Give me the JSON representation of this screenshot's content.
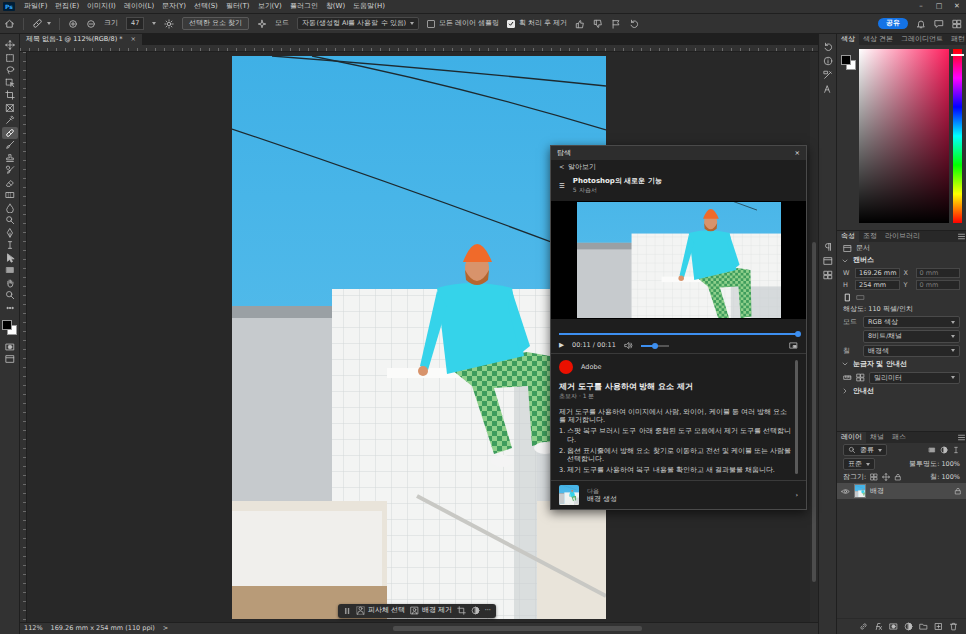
{
  "app": {
    "logo": "Ps"
  },
  "menu": [
    "파일(F)",
    "편집(E)",
    "이미지(I)",
    "레이어(L)",
    "문자(Y)",
    "선택(S)",
    "필터(T)",
    "보기(V)",
    "플러그인",
    "창(W)",
    "도움말(H)"
  ],
  "window_controls": [
    "–",
    "□",
    "✕"
  ],
  "options_bar": {
    "size_label": "크기",
    "size_value": "47",
    "find_button": "선택한 요소 찾기",
    "mode_label": "모드",
    "mode_value": "자동(생성형 AI를 사용할 수 있음)",
    "checks": [
      {
        "label": "모든 레이어 샘플링",
        "checked": false
      },
      {
        "label": "획 처리 후 제거",
        "checked": true
      }
    ],
    "share": "공유"
  },
  "document_tab": {
    "title": "제목 없음-1 @ 112%(RGB/8) *",
    "close": "×"
  },
  "tools": [
    {
      "selected": false
    },
    {
      "selected": false
    },
    {
      "selected": false
    },
    {
      "selected": false
    },
    {
      "selected": false
    },
    {
      "selected": false
    },
    {
      "selected": false
    },
    {
      "selected": true
    },
    {
      "selected": false
    },
    {
      "selected": false
    },
    {
      "selected": false
    },
    {
      "selected": false
    },
    {
      "selected": false
    },
    {
      "selected": false
    },
    {
      "selected": false
    },
    {
      "selected": false
    },
    {
      "selected": false
    },
    {
      "selected": false
    },
    {
      "selected": false
    },
    {
      "selected": false
    },
    {
      "selected": false
    },
    {
      "selected": false
    }
  ],
  "context_bar": {
    "buttons": [
      "피사체 선택",
      "배경 제거"
    ],
    "more": "···"
  },
  "status_bar": {
    "zoom": "112%",
    "info": "169.26 mm x 254 mm (110 ppi)",
    "arrow": ">"
  },
  "help_panel": {
    "title": "탐색",
    "close": "×",
    "back_arrow": "<",
    "back": "알아보기",
    "menu_glyph": "☰",
    "series_title": "Photoshop의 새로운 기능",
    "series_count": "5 자습서",
    "video": {
      "play": "▶",
      "time": "00:11 / 00:11",
      "progress": {
        "level": 1
      },
      "volume": {
        "level": 0.5
      }
    },
    "author": "Adobe",
    "lesson_title": "제거 도구를 사용하여 방해 요소 제거",
    "lesson_meta": "초보자 · 1 분",
    "intro": "제거 도구를 사용하여 이미지에서 사람, 와이어, 케이블 등 여러 방해 요소를 제거합니다.",
    "steps": [
      "1. 스팟 복구 브러시 도구 아래 중첩된 도구 모음에서 제거 도구를 선택합니다.",
      "2. 옵션 표시줄에서 방해 요소 찾기로 이동하고 전선 및 케이블 또는 사람을 선택합니다.",
      "3. 제거 도구를 사용하여 복구 내용을 확인하고 새 결과물을 채웁니다."
    ],
    "next": {
      "label": "다음",
      "title": "배경 생성",
      "arrow": "›"
    }
  },
  "right_panels": {
    "color": {
      "tabs": [
        {
          "label": "색상",
          "selected": true
        },
        {
          "label": "색상 견본",
          "selected": false
        },
        {
          "label": "그레이디언트",
          "selected": false
        },
        {
          "label": "패턴",
          "selected": false
        }
      ],
      "swatches": [
        {
          "kind": "foreground",
          "color": "#000000"
        },
        {
          "kind": "background",
          "color": "#ffffff"
        }
      ],
      "hue": {
        "level": 0.97,
        "color": "#ff1f5e"
      }
    },
    "properties": {
      "tabs": [
        {
          "label": "속성",
          "selected": true
        },
        {
          "label": "조정",
          "selected": false
        },
        {
          "label": "라이브러리",
          "selected": false
        }
      ],
      "doc_label": "문서",
      "canvas_header": "캔버스",
      "fields": [
        {
          "label": "W",
          "value": "169.26 mm",
          "pair_label": "X",
          "pair_value": "0 mm"
        },
        {
          "label": "H",
          "value": "254 mm",
          "pair_label": "Y",
          "pair_value": "0 mm"
        }
      ],
      "orientation": [
        {
          "selected": true
        },
        {
          "selected": false
        }
      ],
      "resolution": "해상도: 110 픽셀/인치",
      "mode_label": "모드",
      "mode_value": "RGB 색상",
      "depth_value": "8비트/채널",
      "fill_label": "칠",
      "fill_value": "배경색",
      "rulers_header": "눈금자 및 안내선",
      "units_value": "밀리미터",
      "guides_header": "안내선"
    },
    "layers": {
      "tabs": [
        {
          "label": "레이어",
          "selected": true
        },
        {
          "label": "채널",
          "selected": false
        },
        {
          "label": "패스",
          "selected": false
        }
      ],
      "filter": "종류",
      "blend": "표준",
      "opacity": "불투명도: 100%",
      "lock": "잠그기:",
      "fill": "칠: 100%",
      "items": [
        {
          "name": "배경",
          "visible": true,
          "locked": true,
          "selected": true
        }
      ]
    }
  }
}
